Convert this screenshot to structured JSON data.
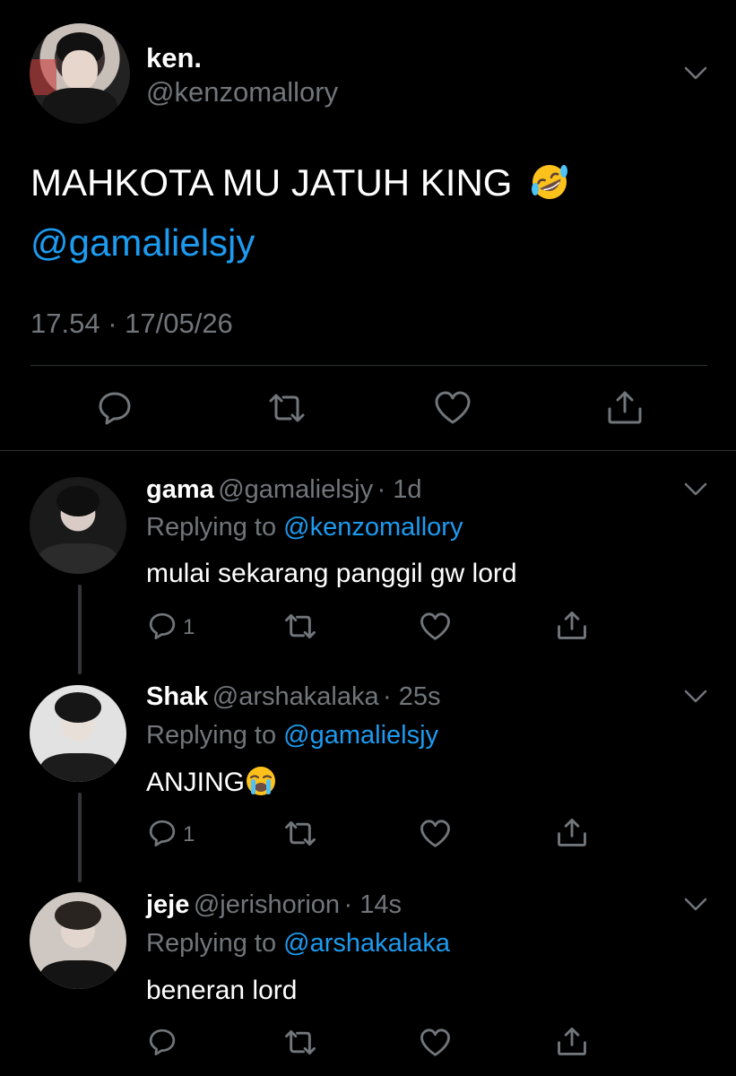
{
  "main_tweet": {
    "display_name": "ken.",
    "handle": "@kenzomallory",
    "text": "MAHKOTA MU JATUH KING",
    "emoji": "rolling-on-floor-laughing",
    "mention": "@gamalielsjy",
    "timestamp": "17.54 · 17/05/26"
  },
  "replies": [
    {
      "display_name": "gama",
      "handle": "@gamalielsjy",
      "age": "· 1d",
      "replying_label": "Replying to",
      "replying_to": "@kenzomallory",
      "text": "mulai sekarang panggil gw lord",
      "reply_count": "1"
    },
    {
      "display_name": "Shak",
      "handle": "@arshakalaka",
      "age": "· 25s",
      "replying_label": "Replying to",
      "replying_to": "@gamalielsjy",
      "text": "ANJING",
      "emoji": "loudly-crying-face",
      "reply_count": "1"
    },
    {
      "display_name": "jeje",
      "handle": "@jerishorion",
      "age": "· 14s",
      "replying_label": "Replying to",
      "replying_to": "@arshakalaka",
      "text": "beneran lord",
      "reply_count": ""
    }
  ],
  "colors": {
    "background": "#000000",
    "text": "#ffffff",
    "secondary": "#71767b",
    "link": "#1d9bf0",
    "divider": "#2f3336"
  }
}
